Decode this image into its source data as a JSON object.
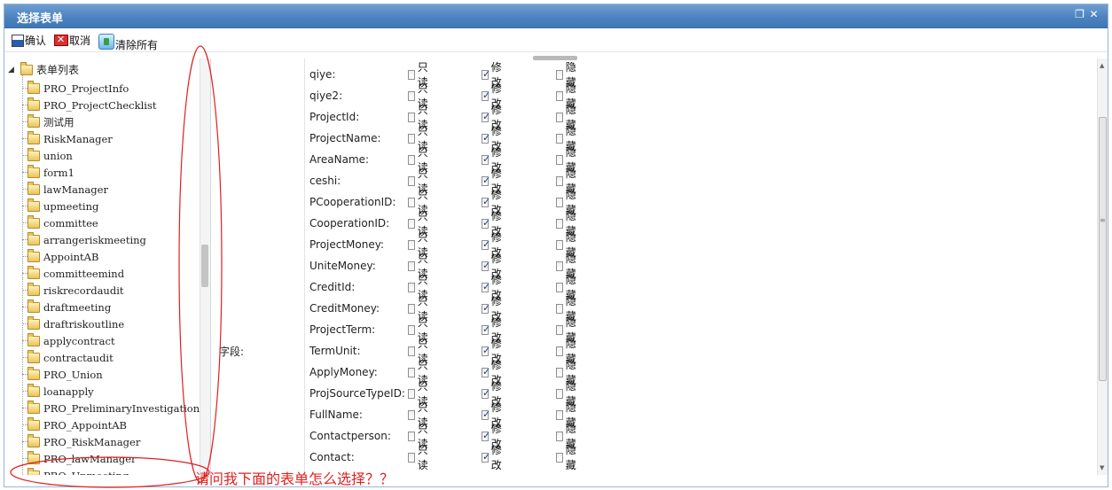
{
  "window": {
    "title": "选择表单"
  },
  "toolbar": {
    "confirm": "确认",
    "cancel": "取消",
    "clear_all": "清除所有"
  },
  "tree": {
    "root_label": "表单列表",
    "items": [
      "PRO_ProjectInfo",
      "PRO_ProjectChecklist",
      "测试用",
      "RiskManager",
      "union",
      "form1",
      "lawManager",
      "upmeeting",
      "committee",
      "arrangeriskmeeting",
      "AppointAB",
      "committeemind",
      "riskrecordaudit",
      "draftmeeting",
      "draftriskoutline",
      "applycontract",
      "contractaudit",
      "PRO_Union",
      "loanapply",
      "PRO_PreliminaryInvestigation",
      "PRO_AppointAB",
      "PRO_RiskManager",
      "PRO_lawManager",
      "PRO_Upmeeting"
    ]
  },
  "form": {
    "caption": "字段:",
    "option_labels": {
      "readonly": "只读",
      "modify": "修改",
      "hidden": "隐藏"
    },
    "fields": [
      {
        "name": "qiye:",
        "readonly": false,
        "modify": true,
        "hidden": false
      },
      {
        "name": "qiye2:",
        "readonly": false,
        "modify": true,
        "hidden": false
      },
      {
        "name": "ProjectId:",
        "readonly": false,
        "modify": true,
        "hidden": false
      },
      {
        "name": "ProjectName:",
        "readonly": false,
        "modify": true,
        "hidden": false
      },
      {
        "name": "AreaName:",
        "readonly": false,
        "modify": true,
        "hidden": false
      },
      {
        "name": "ceshi:",
        "readonly": false,
        "modify": true,
        "hidden": false
      },
      {
        "name": "PCooperationID:",
        "readonly": false,
        "modify": true,
        "hidden": false
      },
      {
        "name": "CooperationID:",
        "readonly": false,
        "modify": true,
        "hidden": false
      },
      {
        "name": "ProjectMoney:",
        "readonly": false,
        "modify": true,
        "hidden": false
      },
      {
        "name": "UniteMoney:",
        "readonly": false,
        "modify": true,
        "hidden": false
      },
      {
        "name": "CreditId:",
        "readonly": false,
        "modify": true,
        "hidden": false
      },
      {
        "name": "CreditMoney:",
        "readonly": false,
        "modify": true,
        "hidden": false
      },
      {
        "name": "ProjectTerm:",
        "readonly": false,
        "modify": true,
        "hidden": false
      },
      {
        "name": "TermUnit:",
        "readonly": false,
        "modify": true,
        "hidden": false
      },
      {
        "name": "ApplyMoney:",
        "readonly": false,
        "modify": true,
        "hidden": false
      },
      {
        "name": "ProjSourceTypeID:",
        "readonly": false,
        "modify": true,
        "hidden": false
      },
      {
        "name": "FullName:",
        "readonly": false,
        "modify": true,
        "hidden": false
      },
      {
        "name": "Contactperson:",
        "readonly": false,
        "modify": true,
        "hidden": false
      },
      {
        "name": "Contact:",
        "readonly": false,
        "modify": true,
        "hidden": false
      }
    ]
  },
  "annotation": {
    "text": "请问我下面的表单怎么选择？？",
    "color": "#e02020"
  }
}
